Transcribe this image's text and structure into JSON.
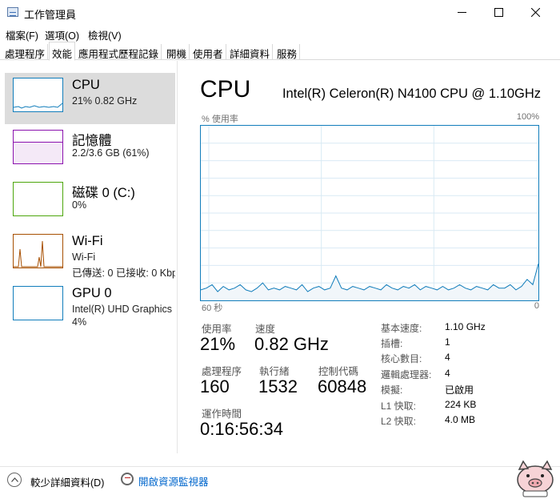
{
  "window": {
    "title": "工作管理員"
  },
  "menu": [
    "檔案(F)",
    "選項(O)",
    "檢視(V)"
  ],
  "tabs": [
    "處理程序",
    "效能",
    "應用程式歷程記錄",
    "開機",
    "使用者",
    "詳細資料",
    "服務"
  ],
  "sidebar": {
    "items": [
      {
        "title": "CPU",
        "line1": "21%  0.82 GHz",
        "color": "#117dbb"
      },
      {
        "title": "記憶體",
        "line1": "2.2/3.6 GB (61%)",
        "color": "#8b12ae"
      },
      {
        "title": "磁碟 0 (C:)",
        "line1": "0%",
        "color": "#4da60c"
      },
      {
        "title": "Wi-Fi",
        "line1": "Wi-Fi",
        "line2": "已傳送: 0  已接收: 0 Kbps",
        "color": "#a74f01"
      },
      {
        "title": "GPU 0",
        "line1": "Intel(R) UHD Graphics",
        "line2": "4%",
        "color": "#117dbb"
      }
    ]
  },
  "main": {
    "title": "CPU",
    "cpu_name": "Intel(R) Celeron(R) N4100 CPU @ 1.10GHz",
    "graph": {
      "y_label": "% 使用率",
      "y_max_label": "100%",
      "x_left_label": "60 秒",
      "x_right_label": "0",
      "line_color": "#117dbb",
      "usage_history": [
        6,
        7,
        9,
        5,
        8,
        6,
        7,
        9,
        6,
        5,
        7,
        10,
        6,
        7,
        6,
        8,
        7,
        6,
        9,
        5,
        7,
        8,
        6,
        7,
        14,
        7,
        6,
        8,
        7,
        6,
        8,
        7,
        6,
        9,
        7,
        6,
        8,
        7,
        9,
        6,
        8,
        7,
        6,
        8,
        6,
        7,
        9,
        7,
        6,
        8,
        7,
        6,
        9,
        7,
        7,
        9,
        6,
        8,
        12,
        9,
        21
      ]
    },
    "stats": {
      "utilization_label": "使用率",
      "utilization": "21%",
      "speed_label": "速度",
      "speed": "0.82 GHz",
      "processes_label": "處理程序",
      "processes": "160",
      "threads_label": "執行緒",
      "threads": "1532",
      "handles_label": "控制代碼",
      "handles": "60848",
      "uptime_label": "運作時間",
      "uptime": "0:16:56:34"
    },
    "specs": [
      {
        "label": "基本速度:",
        "value": "1.10 GHz"
      },
      {
        "label": "插槽:",
        "value": "1"
      },
      {
        "label": "核心數目:",
        "value": "4"
      },
      {
        "label": "邏輯處理器:",
        "value": "4"
      },
      {
        "label": "模擬:",
        "value": "已啟用"
      },
      {
        "label": "L1 快取:",
        "value": "224 KB"
      },
      {
        "label": "L2 快取:",
        "value": "4.0 MB"
      }
    ]
  },
  "footer": {
    "fewer_details": "較少詳細資料(D)",
    "open_monitor": "開啟資源監視器"
  }
}
